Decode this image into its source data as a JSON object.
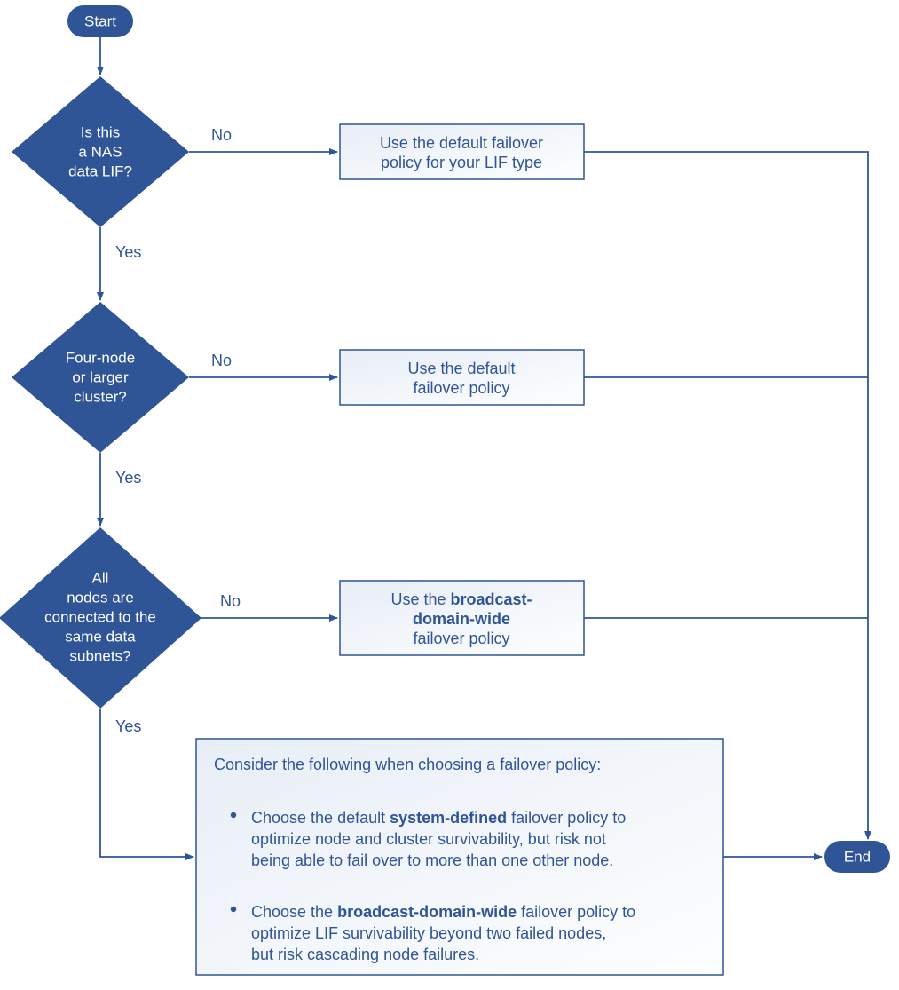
{
  "colors": {
    "primary": "#2f5597",
    "primaryStroke": "#2f5597",
    "boxFillLight": "#f5f8fc",
    "boxStroke": "#2f5597",
    "arrow": "#2f5597"
  },
  "start": {
    "label": "Start"
  },
  "end": {
    "label": "End"
  },
  "decisions": {
    "d1": {
      "l1": "Is this",
      "l2": "a NAS",
      "l3": "data LIF?"
    },
    "d2": {
      "l1": "Four-node",
      "l2": "or larger",
      "l3": "cluster?"
    },
    "d3": {
      "l1": "All",
      "l2": "nodes are",
      "l3": "connected to the",
      "l4": "same data",
      "l5": "subnets?"
    }
  },
  "branches": {
    "yes": "Yes",
    "no": "No"
  },
  "boxes": {
    "b1": {
      "l1": "Use the default failover",
      "l2": "policy for your LIF type"
    },
    "b2": {
      "l1": "Use the default",
      "l2": "failover policy"
    },
    "b3": {
      "l1a": "Use the ",
      "l1b": "broadcast-",
      "l2a": "domain-wide",
      "l3": "failover policy"
    }
  },
  "final": {
    "intro": "Consider the following when choosing a failover policy:",
    "bullet1": {
      "l1a": "Choose the default ",
      "l1b": "system-defined",
      "l1c": " failover policy to",
      "l2": "optimize node and cluster survivability, but risk not",
      "l3": "being able to fail over to more than one other node."
    },
    "bullet2": {
      "l1a": "Choose the ",
      "l1b": "broadcast-domain-wide",
      "l1c": " failover policy to",
      "l2": "optimize LIF survivability beyond two failed nodes,",
      "l3": "but risk cascading node failures."
    }
  }
}
